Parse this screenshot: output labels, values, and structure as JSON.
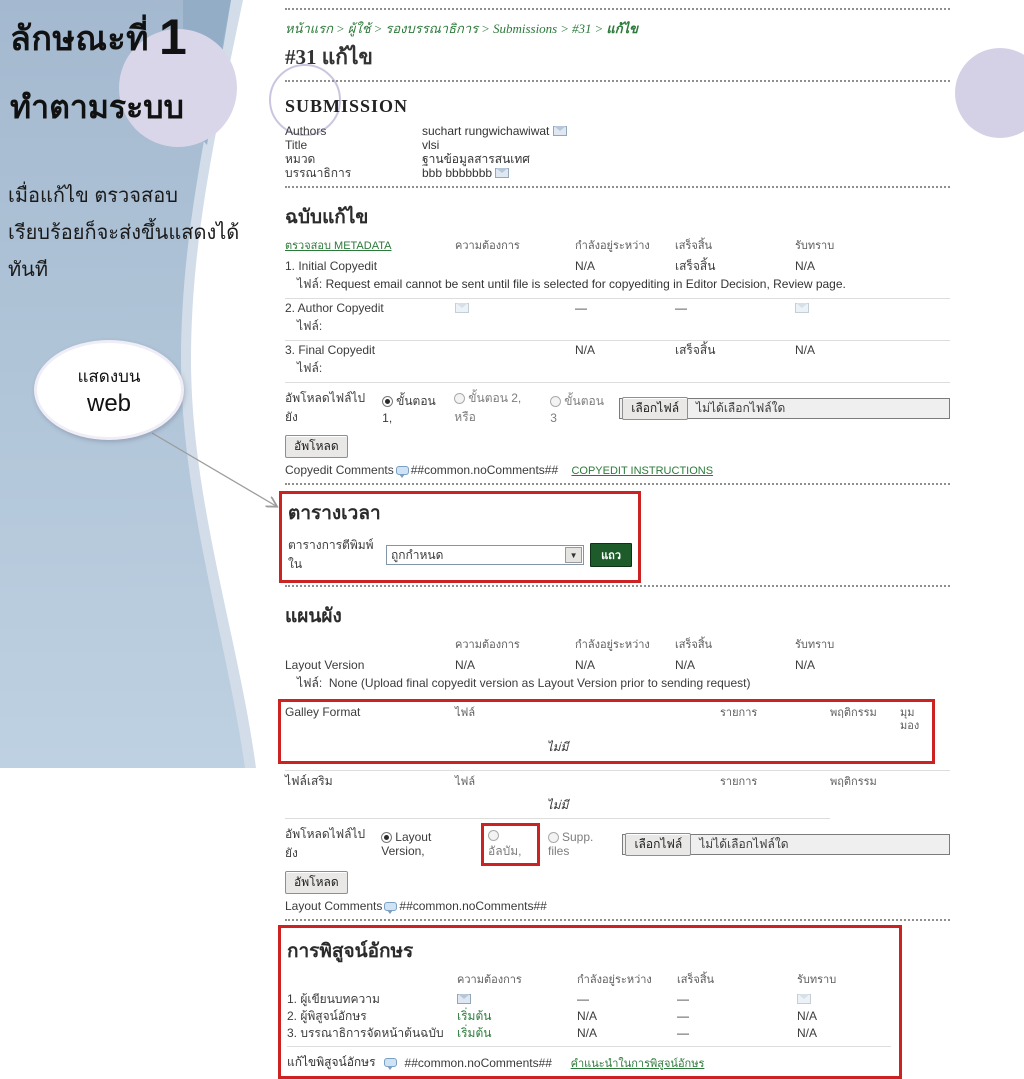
{
  "slide": {
    "title_text": "ลักษณะที่",
    "title_number": "1",
    "subtitle": "ทำตามระบบ",
    "body_lines": [
      "เมื่อแก้ไข ตรวจสอบ",
      "เรียบร้อยก็จะส่งขึ้นแสดงได้",
      "ทันที"
    ],
    "callout": {
      "line1": "แสดงบน",
      "line2": "web"
    },
    "colors": {
      "panel_blue": "#a9bed3",
      "lavender": "#d9d5e9",
      "highlight_red": "#cc2222"
    }
  },
  "breadcrumb": {
    "items": [
      "หน้าแรก",
      "ผู้ใช้",
      "รองบรรณาธิการ",
      "Submissions",
      "#31"
    ],
    "current": "แก้ไข",
    "separator": ">"
  },
  "page_title": "#31 แก้ไข",
  "submission": {
    "heading": "SUBMISSION",
    "authors_label": "Authors",
    "authors_value": "suchart rungwichawiwat",
    "title_label": "Title",
    "title_value": "vlsi",
    "section_label": "หมวด",
    "section_value": "ฐานข้อมูลสารสนเทศ",
    "editor_label": "บรรณาธิการ",
    "editor_value": "bbb bbbbbbb"
  },
  "status_headers": [
    "ความต้องการ",
    "กำลังอยู่ระหว่าง",
    "เสร็จสิ้น",
    "รับทราบ"
  ],
  "copyedit": {
    "heading": "ฉบับแก้ไข",
    "metadata_link": "ตรวจสอบ METADATA",
    "file_label": "ไฟล์:",
    "row1": {
      "label": "1. Initial Copyedit",
      "underway": "N/A",
      "complete": "เสร็จสิ้น",
      "acknowledge": "N/A",
      "file_note": "Request email cannot be sent until file is selected for copyediting in Editor Decision, Review page."
    },
    "row2": {
      "label": "2. Author Copyedit",
      "underway": "—",
      "complete": "—"
    },
    "row3": {
      "label": "3. Final Copyedit",
      "underway": "N/A",
      "complete": "เสร็จสิ้น",
      "acknowledge": "N/A"
    },
    "upload_label": "อัพโหลดไฟล์ไปยัง",
    "step1": "ขั้นตอน 1,",
    "step2": "ขั้นตอน 2, หรือ",
    "step3": "ขั้นตอน 3",
    "choose_file": "เลือกไฟล์",
    "no_file": "ไม่ได้เลือกไฟล์ใด",
    "upload_button": "อัพโหลด",
    "comments_label": "Copyedit Comments",
    "comments_token": "##common.noComments##",
    "instructions_link": "COPYEDIT INSTRUCTIONS"
  },
  "schedule": {
    "heading": "ตารางเวลา",
    "label": "ตารางการตีพิมพ์ใน",
    "select_value": "ถูกกำหนด",
    "record_button": "แถว"
  },
  "layout": {
    "heading": "แผนผัง",
    "version_label": "Layout Version",
    "version_values": [
      "N/A",
      "N/A",
      "N/A",
      "N/A"
    ],
    "file_label": "ไฟล์:",
    "file_note": "None (Upload final copyedit version as Layout Version prior to sending request)",
    "galley_label": "Galley Format",
    "galley_headers": [
      "ไฟล์",
      "รายการ",
      "พฤติกรรม",
      "มุมมอง"
    ],
    "galley_empty": "ไม่มี",
    "supp_label": "ไฟล์เสริม",
    "supp_headers": [
      "ไฟล์",
      "รายการ",
      "พฤติกรรม"
    ],
    "supp_empty": "ไม่มี",
    "upload_label": "อัพโหลดไฟล์ไปยัง",
    "opt1": "Layout Version,",
    "opt2": "อัลบัม,",
    "opt3": "Supp. files",
    "choose_file": "เลือกไฟล์",
    "no_file": "ไม่ได้เลือกไฟล์ใด",
    "upload_button": "อัพโหลด",
    "comments_label": "Layout Comments",
    "comments_token": "##common.noComments##"
  },
  "proofread": {
    "heading": "การพิสูจน์อักษร",
    "row1": {
      "label": "1. ผู้เขียนบทความ",
      "underway": "—",
      "complete": "—"
    },
    "row2": {
      "label": "2. ผู้พิสูจน์อักษร",
      "request": "เริ่มต้น",
      "underway": "N/A",
      "complete": "—",
      "acknowledge": "N/A"
    },
    "row3": {
      "label": "3. บรรณาธิการจัดหน้าต้นฉบับ",
      "request": "เริ่มต้น",
      "underway": "N/A",
      "complete": "—",
      "acknowledge": "N/A"
    },
    "footer_label": "แก้ไขพิสูจน์อักษร",
    "footer_token": "##common.noComments##",
    "footer_link": "คำแนะนำในการพิสูจน์อักษร"
  }
}
